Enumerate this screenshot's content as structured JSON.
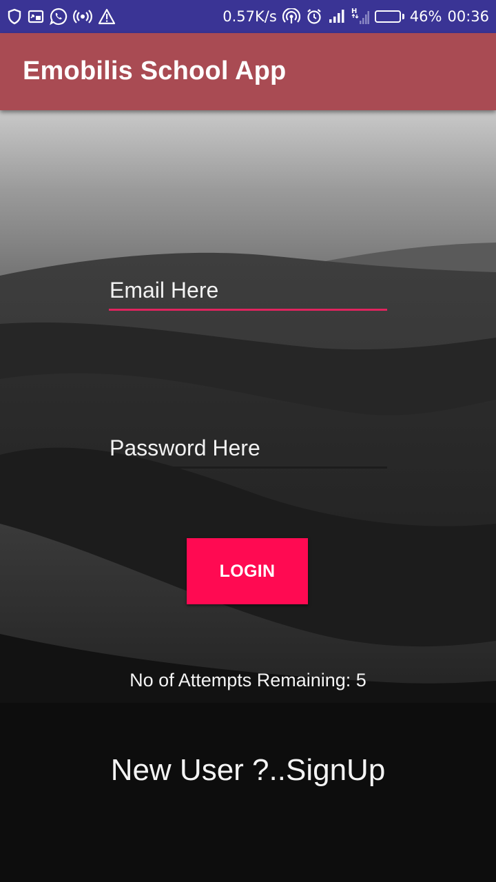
{
  "status_bar": {
    "left_icons": [
      "shield-icon",
      "screen-cast-icon",
      "whatsapp-icon",
      "hotspot-icon",
      "warning-icon"
    ],
    "network_speed": "0.57K/s",
    "right_icons": [
      "wireless-data-icon",
      "alarm-icon",
      "signal-icon",
      "h-signal-icon"
    ],
    "battery_level": 0.46,
    "battery_percent": "46%",
    "time": "00:36"
  },
  "app_bar": {
    "title": "Emobilis School App"
  },
  "login_form": {
    "email_placeholder": "Email Here",
    "email_value": "",
    "password_placeholder": "Password Here",
    "password_value": "",
    "login_label": "LOGIN",
    "attempts_text": "No of Attempts Remaining: 5",
    "signup_text": "New User ?..SignUp"
  },
  "colors": {
    "status_bar": "#3a3495",
    "app_bar": "#a94b53",
    "accent": "#ff0a52",
    "email_underline": "#e0245e",
    "password_underline": "#1c1c1c"
  }
}
